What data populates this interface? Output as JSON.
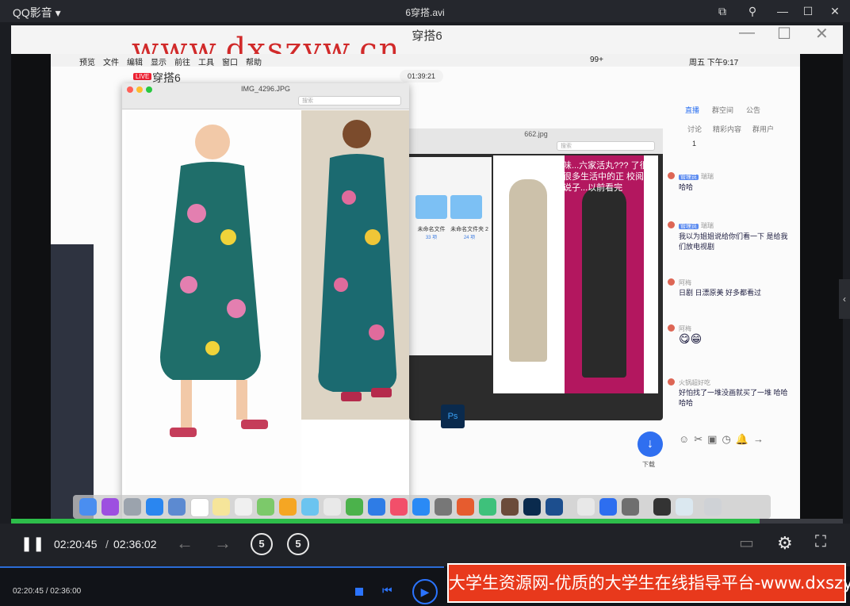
{
  "player": {
    "app_name": "QQ影音",
    "file_title": "6穿搭.avi",
    "progress": 0.9,
    "time_current": "02:20:45",
    "time_separator": "/",
    "time_total": "02:36:02",
    "skip_back_label": "5",
    "skip_forward_label": "5",
    "bottom_time": "02:20:45 / 02:36:00",
    "accent_color": "#2dbd4a"
  },
  "video": {
    "inner_title": "穿搭6",
    "watermark": "www.dxszyw.cn",
    "banner": "大学生资源网-优质的大学生在线指导平台-www.dxszyw.cn"
  },
  "mac": {
    "menu": [
      "预览",
      "文件",
      "编辑",
      "显示",
      "前往",
      "工具",
      "窗口",
      "帮助"
    ],
    "status_right": "周五 下午9:17",
    "battery": "99+",
    "live_title": "穿搭6",
    "live_badge": "LIVE",
    "record_time": "01:39:21",
    "preview_title": "IMG_4296.JPG",
    "preview_search": "搜索",
    "preview2_title": "662.jpg",
    "preview2_search": "搜索",
    "folders": [
      {
        "label": "未命名文件",
        "count": "33 项"
      },
      {
        "label": "未命名文件夹 2",
        "count": "24 项"
      }
    ],
    "overlay_text": "味...六家活丸??? 了很多很多生活中的正 校阅部 说子...以前看完",
    "ps_label": "Ps",
    "tabs": [
      "直播",
      "群空间",
      "公告"
    ],
    "subtabs": [
      "讨论",
      "精彩内容",
      "群用户"
    ],
    "chat_count": "1",
    "chats": [
      {
        "tag": "管理员",
        "name": "瑞瑞",
        "text": "哈哈"
      },
      {
        "tag": "管理员",
        "name": "瑞瑞",
        "text": "我以为姐姐说给你们看一下 是给我们放电视剧"
      },
      {
        "tag": "",
        "name": "阿梅",
        "text": "日剧 日漂原美 好多都看过"
      },
      {
        "tag": "",
        "name": "阿梅",
        "text": "😋😁"
      },
      {
        "tag": "",
        "name": "火锅超好吃",
        "text": "好怕找了一堆没画就买了一堆 哈哈哈哈"
      }
    ],
    "download_label": "下载"
  }
}
